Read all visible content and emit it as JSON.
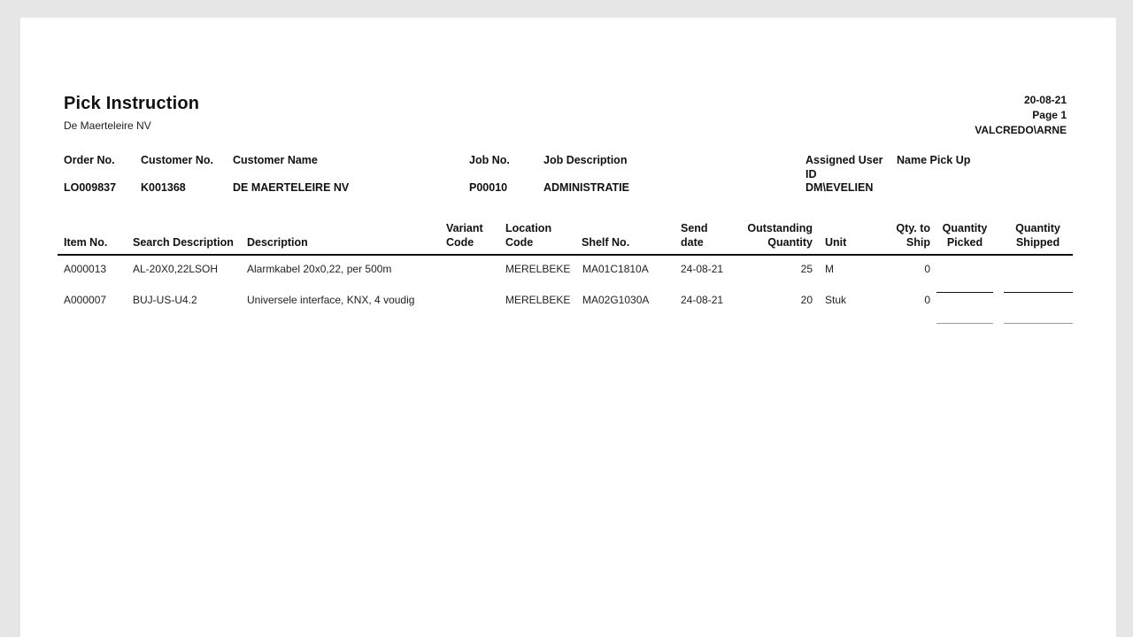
{
  "report": {
    "title": "Pick Instruction",
    "company": "De Maerteleire NV",
    "date": "20-08-21",
    "page": "Page 1",
    "user": "VALCREDO\\ARNE"
  },
  "header_fields": {
    "order_no": {
      "label": "Order No.",
      "value": "LO009837"
    },
    "customer_no": {
      "label": "Customer No.",
      "value": "K001368"
    },
    "customer_name": {
      "label": "Customer Name",
      "value": "DE MAERTELEIRE NV"
    },
    "job_no": {
      "label": "Job No.",
      "value": "P00010"
    },
    "job_description": {
      "label": "Job Description",
      "value": "ADMINISTRATIE"
    },
    "assigned_user_id": {
      "label_line1": "Assigned User",
      "label_line2": "ID",
      "value": "DM\\EVELIEN"
    },
    "name_pick_up": {
      "label": "Name Pick Up",
      "value": ""
    }
  },
  "columns": {
    "item_no": {
      "line1": "",
      "line2": "Item  No."
    },
    "search_description": {
      "line1": "",
      "line2": "Search Description"
    },
    "description": {
      "line1": "",
      "line2": "Description"
    },
    "variant_code": {
      "line1": "Variant",
      "line2": "Code"
    },
    "location_code": {
      "line1": "Location",
      "line2": "Code"
    },
    "shelf_no": {
      "line1": "",
      "line2": "Shelf No."
    },
    "send_date": {
      "line1": "Send",
      "line2": "date"
    },
    "outstanding_quantity": {
      "line1": "Outstanding",
      "line2": "Quantity"
    },
    "unit": {
      "line1": "",
      "line2": "Unit"
    },
    "qty_to_ship": {
      "line1": "Qty. to",
      "line2": "Ship"
    },
    "quantity_picked": {
      "line1": "Quantity",
      "line2": "Picked"
    },
    "quantity_shipped": {
      "line1": "Quantity",
      "line2": "Shipped"
    }
  },
  "rows": [
    {
      "item_no": "A000013",
      "search_description": "AL-20X0,22LSOH",
      "description": "Alarmkabel 20x0,22, per 500m",
      "variant_code": "",
      "location_code": "MERELBEKE",
      "shelf_no": "MA01C1810A",
      "send_date": "24-08-21",
      "outstanding_quantity": "25",
      "unit": "M",
      "qty_to_ship": "0"
    },
    {
      "item_no": "A000007",
      "search_description": "BUJ-US-U4.2",
      "description": "Universele interface, KNX, 4 voudig",
      "variant_code": "",
      "location_code": "MERELBEKE",
      "shelf_no": "MA02G1030A",
      "send_date": "24-08-21",
      "outstanding_quantity": "20",
      "unit": "Stuk",
      "qty_to_ship": "0"
    }
  ]
}
